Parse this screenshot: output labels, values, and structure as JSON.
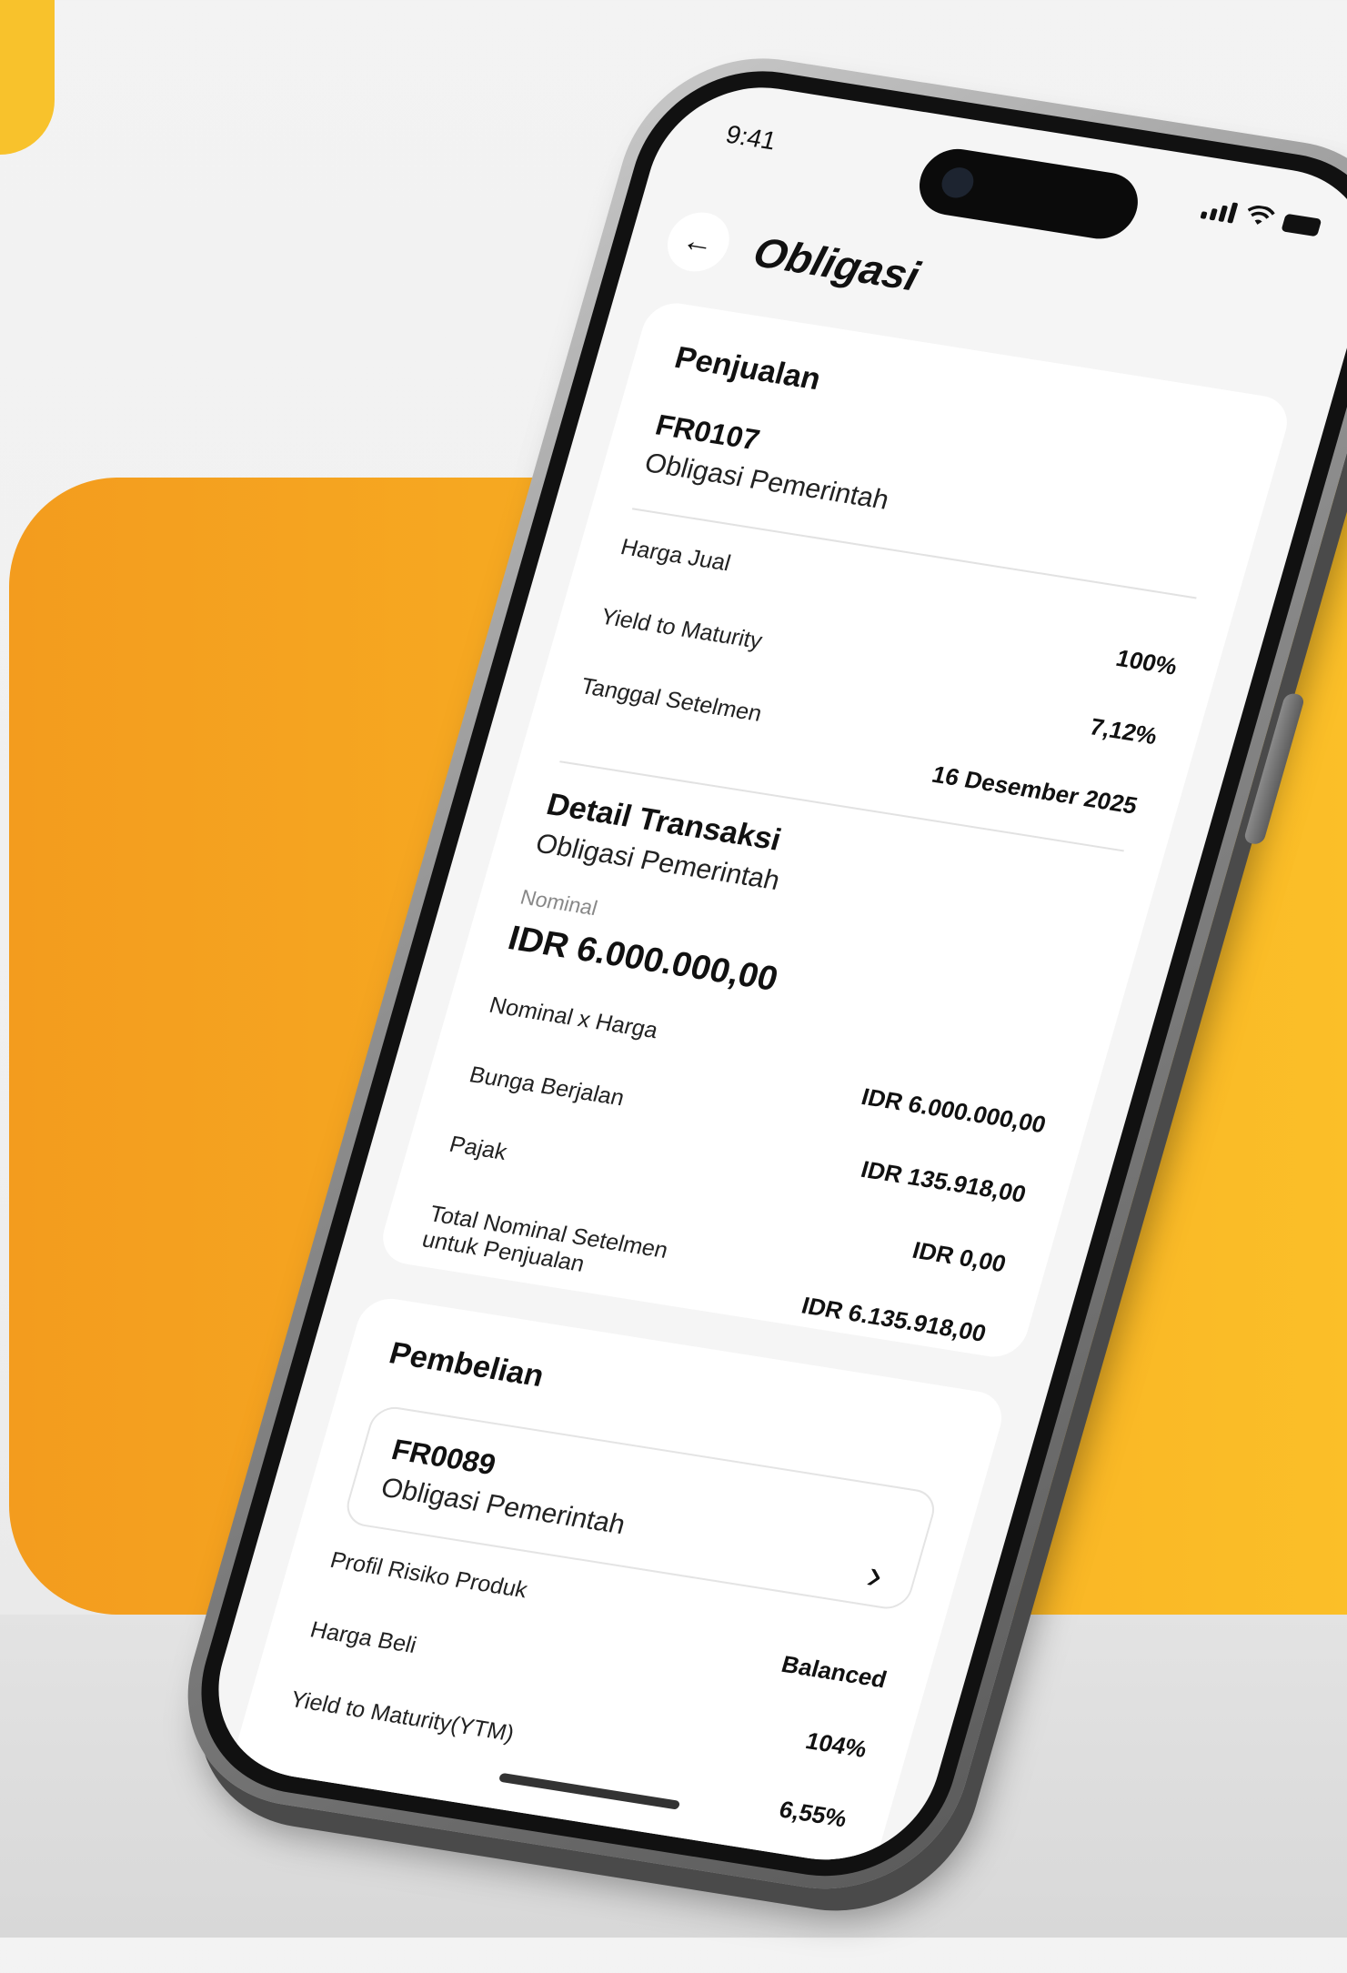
{
  "status_bar": {
    "time": "9:41"
  },
  "header": {
    "back_icon": "←",
    "title": "Obligasi"
  },
  "sell_card": {
    "section_title": "Penjualan",
    "code": "FR0107",
    "type": "Obligasi Pemerintah",
    "rows": [
      {
        "label": "Harga Jual",
        "value": "100%"
      },
      {
        "label": "Yield to Maturity",
        "value": "7,12%"
      },
      {
        "label": "Tanggal Setelmen",
        "value": "16 Desember 2025"
      }
    ],
    "detail": {
      "title": "Detail Transaksi",
      "subtitle": "Obligasi Pemerintah",
      "nominal_label": "Nominal",
      "nominal_value": "IDR 6.000.000,00",
      "rows": [
        {
          "label": "Nominal x Harga",
          "value": "IDR 6.000.000,00"
        },
        {
          "label": "Bunga Berjalan",
          "value": "IDR 135.918,00"
        },
        {
          "label": "Pajak",
          "value": "IDR 0,00"
        },
        {
          "label": "Total Nominal Setelmen untuk Penjualan",
          "value": "IDR 6.135.918,00"
        }
      ]
    }
  },
  "buy_card": {
    "section_title": "Pembelian",
    "code": "FR0089",
    "type": "Obligasi Pemerintah",
    "chevron": "›",
    "rows": [
      {
        "label": "Profil Risiko Produk",
        "value": "Balanced"
      },
      {
        "label": "Harga Beli",
        "value": "104%"
      },
      {
        "label": "Yield to Maturity(YTM)",
        "value": "6,55%"
      }
    ]
  }
}
